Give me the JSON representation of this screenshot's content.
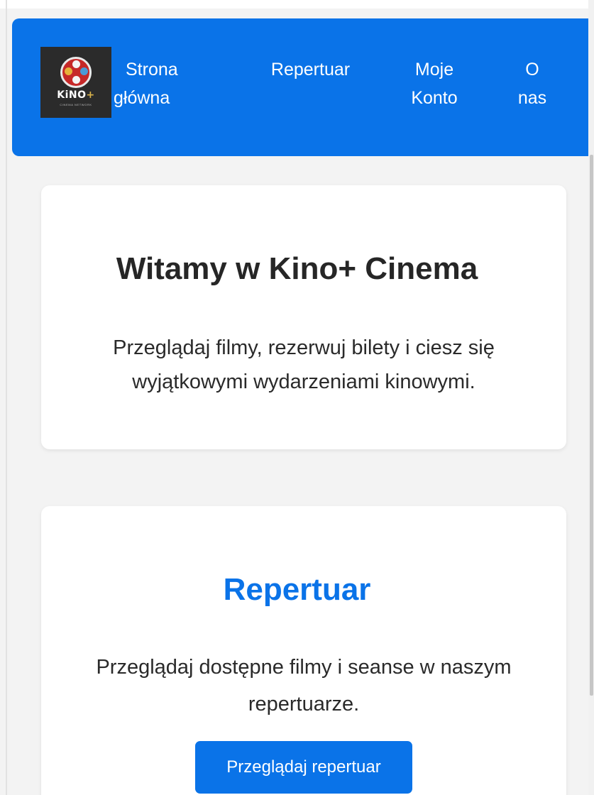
{
  "nav": {
    "logo": {
      "icon": "film-reel-icon",
      "text": "KiNO",
      "plus": "+",
      "subtext": "CINEMA NETWORK"
    },
    "items": [
      {
        "line1": "Strona",
        "line2": "główna"
      },
      {
        "line1": "Repertuar",
        "line2": ""
      },
      {
        "line1": "Moje",
        "line2": "Konto"
      },
      {
        "line1": "O",
        "line2": "nas"
      }
    ]
  },
  "welcome": {
    "title": "Witamy w Kino+ Cinema",
    "text": "Przeglądaj filmy, rezerwuj bilety i ciesz się wyjątkowymi wydarzeniami kinowymi."
  },
  "repertoire": {
    "title": "Repertuar",
    "text": "Przeglądaj dostępne filmy i seanse w naszym repertuarze.",
    "button_label": "Przeglądaj repertuar"
  },
  "colors": {
    "primary": "#0a73e8",
    "background": "#f3f3f3",
    "card": "#ffffff",
    "text": "#262626"
  }
}
